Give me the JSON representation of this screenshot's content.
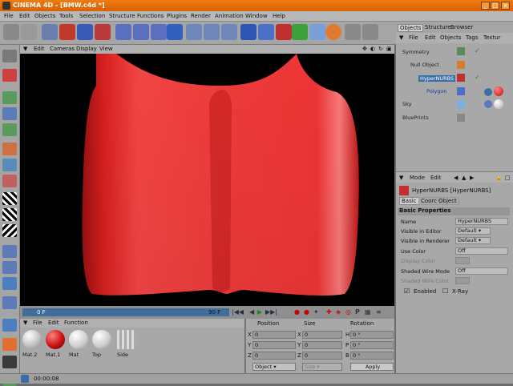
{
  "window": {
    "title": "CINEMA 4D - [BMW.c4d *]"
  },
  "menu": [
    "File",
    "Edit",
    "Objects",
    "Tools",
    "Selection",
    "Structure",
    "Functions",
    "Plugins",
    "Render",
    "Animation",
    "Window",
    "Help"
  ],
  "viewport": {
    "menu": [
      "Edit",
      "Cameras",
      "Display",
      "View"
    ]
  },
  "timeline": {
    "start": "0 F",
    "end": "90 F"
  },
  "materials": {
    "menu": [
      "File",
      "Edit",
      "Function"
    ],
    "items": [
      {
        "label": "Mat.2",
        "color": "#e8e8e8"
      },
      {
        "label": "Mat.1",
        "color": "#cc1111"
      },
      {
        "label": "Mat",
        "color": "#eeeeee"
      },
      {
        "label": "Top",
        "color": "#dddddd"
      },
      {
        "label": "Side",
        "color": "#cfcfcf"
      }
    ]
  },
  "coords": {
    "headers": [
      "Position",
      "Size",
      "Rotation"
    ],
    "pos_labels": [
      "X",
      "Y",
      "Z"
    ],
    "pos_values": [
      "0",
      "0",
      "0"
    ],
    "size_labels": [
      "X",
      "Y",
      "Z"
    ],
    "size_values": [
      "0",
      "0",
      "0"
    ],
    "rot_labels": [
      "H",
      "P",
      "B"
    ],
    "rot_values": [
      "0 °",
      "0 °",
      "0 °"
    ],
    "mode_select": "Object",
    "size_select": "Size",
    "apply": "Apply"
  },
  "status": {
    "time": "00:00:08"
  },
  "right_panel": {
    "tabs": [
      "Objects",
      "Structure",
      "Browser"
    ],
    "menu": [
      "File",
      "Edit",
      "Objects",
      "Tags",
      "Textur"
    ],
    "objects": [
      "Symmetry",
      "Null Object",
      "HyperNURBS",
      "Polygon",
      "Sky",
      "BluePrints"
    ]
  },
  "attributes": {
    "menu": [
      "Mode",
      "Edit"
    ],
    "object_title": "HyperNURBS [HyperNURBS]",
    "tabs": [
      "Basic",
      "Coord",
      "Object"
    ],
    "section": "Basic Properties",
    "rows": [
      {
        "label": "Name",
        "value": "HyperNURBS"
      },
      {
        "label": "Visible in Editor",
        "value": "Default"
      },
      {
        "label": "Visible in Renderer",
        "value": "Default"
      },
      {
        "label": "Use Color",
        "value": "Off"
      },
      {
        "label": "Display Color",
        "value": ""
      },
      {
        "label": "Shaded Wire Mode",
        "value": "Off"
      },
      {
        "label": "Shaded Wire Color",
        "value": ""
      }
    ],
    "enabled": "Enabled",
    "xray": "X-Ray"
  }
}
